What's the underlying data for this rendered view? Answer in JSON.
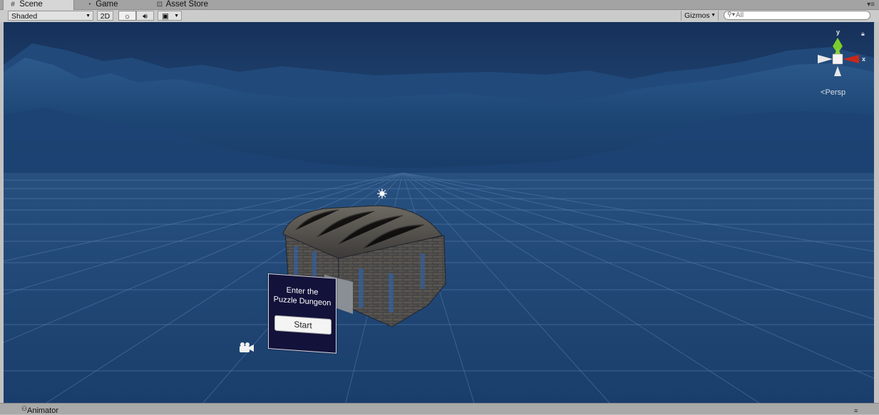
{
  "tabs": [
    {
      "label": "Scene",
      "icon": "grid-icon",
      "active": true
    },
    {
      "label": "Game",
      "icon": "pacman-icon",
      "active": false
    },
    {
      "label": "Asset Store",
      "icon": "bag-icon",
      "active": false
    }
  ],
  "toolbar": {
    "shading_mode": "Shaded",
    "btn_2d": "2D",
    "lighting_icon": "sun-icon",
    "audio_icon": "speaker-icon",
    "effects_icon": "image-icon",
    "gizmos_label": "Gizmos",
    "search_value": "",
    "search_placeholder": "All"
  },
  "scene": {
    "gizmo_axes": {
      "y": "y",
      "x": "x"
    },
    "projection_label": "Persp",
    "canvas": {
      "title_line1": "Enter the",
      "title_line2": "Puzzle Dungeon",
      "button_label": "Start"
    }
  },
  "bottom_panel": {
    "tab_label": "Animator"
  },
  "colors": {
    "sky": "#1c3a66",
    "mountains": "#173a6a",
    "ground": "#1a3d6b",
    "grid": "#5b7fae",
    "axis_y": "#7ccc2c",
    "axis_x": "#c8281c",
    "canvas_bg": "#13123a"
  }
}
